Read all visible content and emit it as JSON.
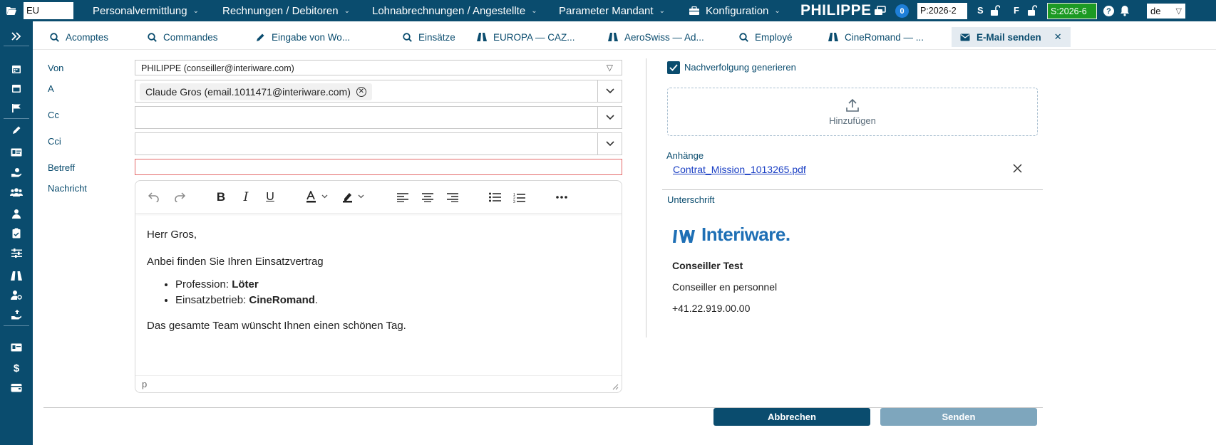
{
  "topbar": {
    "mandant_value": "EU",
    "menus": [
      {
        "label": "Personalvermittlung"
      },
      {
        "label": "Rechnungen / Debitoren"
      },
      {
        "label": "Lohnabrechnungen / Angestellte"
      },
      {
        "label": "Parameter Mandant"
      },
      {
        "label": "Konfiguration"
      }
    ],
    "brand": "PHILIPPE",
    "notification_count": "0",
    "p_period": "P:2026-2",
    "s_label": "S",
    "f_label": "F",
    "s_period": "S:2026-6",
    "language": "de",
    "colors": {
      "bar": "#0a4c6e",
      "s_period_bg": "#1c9a23",
      "badge": "#1e7fd8"
    }
  },
  "sidebar": {
    "icons": [
      "expand-icon",
      "calendar-icon",
      "calendar-check-icon",
      "flag-icon",
      "pencil-icon",
      "id-card-icon",
      "hand-money-icon",
      "users-icon",
      "user-icon",
      "clipboard-icon",
      "sliders-icon",
      "road-icon",
      "user-gear-icon",
      "hand-upload-icon",
      "card-icon",
      "dollar-icon",
      "wallet-icon"
    ]
  },
  "tabs": [
    {
      "label": "Acomptes",
      "icon": "search-icon"
    },
    {
      "label": "Commandes",
      "icon": "search-icon"
    },
    {
      "label": "Eingabe von Wo...",
      "icon": "pencil-icon"
    },
    {
      "label": "Einsätze",
      "icon": "search-icon"
    },
    {
      "label": "EUROPA — CAZ...",
      "icon": "road-icon"
    },
    {
      "label": "AeroSwiss — Ad...",
      "icon": "road-icon"
    },
    {
      "label": "Employé",
      "icon": "search-icon"
    },
    {
      "label": "CineRomand — ...",
      "icon": "road-icon"
    },
    {
      "label": "E-Mail senden",
      "icon": "envelope-icon",
      "active": true
    }
  ],
  "form": {
    "von_label": "Von",
    "von_value": "PHILIPPE (conseiller@interiware.com)",
    "a_label": "A",
    "a_chip": "Claude Gros (email.1011471@interiware.com)",
    "cc_label": "Cc",
    "cci_label": "Cci",
    "betreff_label": "Betreff",
    "betreff_value": "",
    "nachricht_label": "Nachricht"
  },
  "editor": {
    "greeting": "Herr Gros,",
    "intro": "Anbei finden Sie Ihren Einsatzvertrag",
    "item1_label": "Profession: ",
    "item1_value": "Löter",
    "item2_label": "Einsatzbetrieb: ",
    "item2_value": "CineRomand",
    "item2_end": ".",
    "closing": "Das gesamte Team wünscht Ihnen einen schönen Tag.",
    "status": "p"
  },
  "right": {
    "followup_label": "Nachverfolgung generieren",
    "followup_checked": true,
    "upload_label": "Hinzufügen",
    "attachments_label": "Anhänge",
    "attachment_file": "Contrat_Mission_1013265.pdf",
    "signature_label": "Unterschrift",
    "signature_logo_text": "Interiware.",
    "signature_name": "Conseiller Test",
    "signature_role": "Conseiller en personnel",
    "signature_phone": "+41.22.919.00.00"
  },
  "actions": {
    "cancel_label": "Abbrechen",
    "send_label": "Senden",
    "colors": {
      "cancel": "#0a4c6e",
      "send": "#7ea6bd"
    }
  }
}
